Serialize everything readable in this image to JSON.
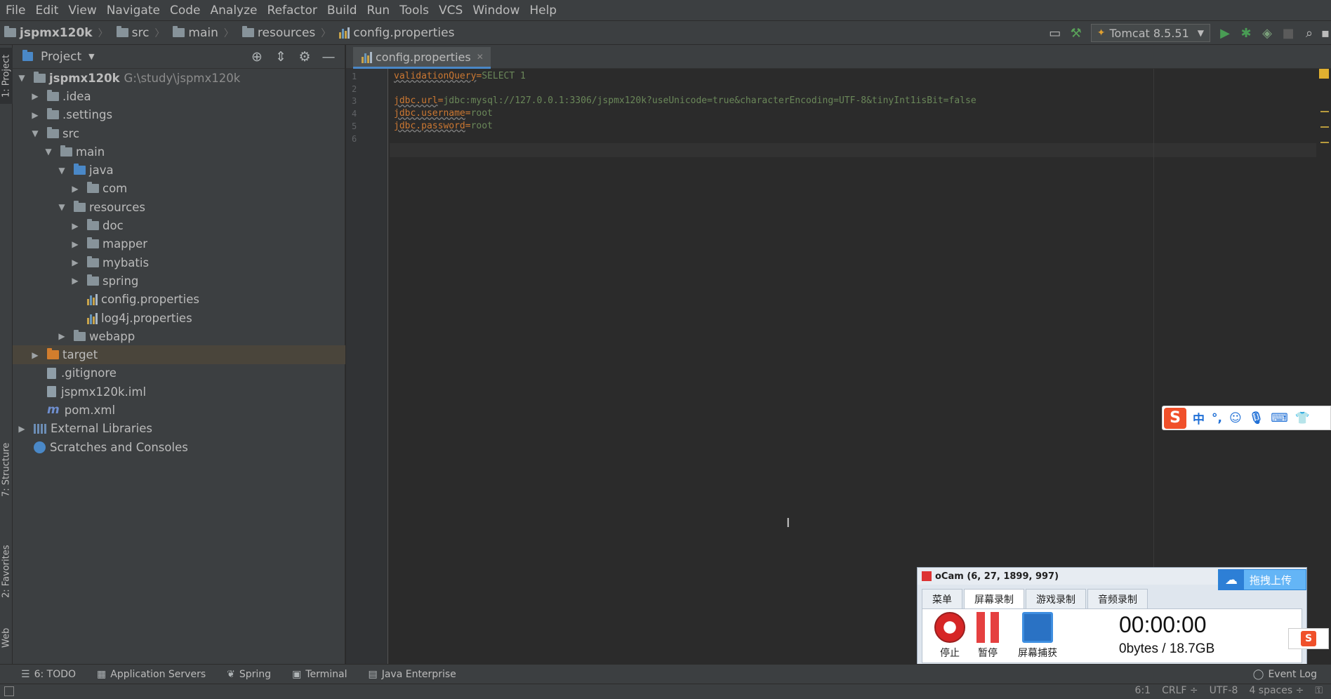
{
  "menu": [
    "File",
    "Edit",
    "View",
    "Navigate",
    "Code",
    "Analyze",
    "Refactor",
    "Build",
    "Run",
    "Tools",
    "VCS",
    "Window",
    "Help"
  ],
  "breadcrumb": [
    "jspmx120k",
    "src",
    "main",
    "resources",
    "config.properties"
  ],
  "run_config": "Tomcat 8.5.51",
  "left_tabs": {
    "project": "1: Project",
    "structure": "7: Structure",
    "favorites": "2: Favorites",
    "web": "Web"
  },
  "project_panel": {
    "title": "Project",
    "tree": [
      {
        "label": "jspmx120k",
        "sub": "G:\\study\\jspmx120k",
        "depth": 0,
        "arrow": "down",
        "icon": "module-folder-icon",
        "bold": true
      },
      {
        "label": ".idea",
        "depth": 1,
        "arrow": "right",
        "icon": "folder-icon"
      },
      {
        "label": ".settings",
        "depth": 1,
        "arrow": "right",
        "icon": "folder-icon"
      },
      {
        "label": "src",
        "depth": 1,
        "arrow": "down",
        "icon": "folder-icon"
      },
      {
        "label": "main",
        "depth": 2,
        "arrow": "down",
        "icon": "folder-icon"
      },
      {
        "label": "java",
        "depth": 3,
        "arrow": "down",
        "icon": "source-folder-icon"
      },
      {
        "label": "com",
        "depth": 4,
        "arrow": "right",
        "icon": "package-icon"
      },
      {
        "label": "resources",
        "depth": 3,
        "arrow": "down",
        "icon": "resources-folder-icon"
      },
      {
        "label": "doc",
        "depth": 4,
        "arrow": "right",
        "icon": "package-icon"
      },
      {
        "label": "mapper",
        "depth": 4,
        "arrow": "right",
        "icon": "package-icon"
      },
      {
        "label": "mybatis",
        "depth": 4,
        "arrow": "right",
        "icon": "package-icon"
      },
      {
        "label": "spring",
        "depth": 4,
        "arrow": "right",
        "icon": "package-icon"
      },
      {
        "label": "config.properties",
        "depth": 4,
        "arrow": "none",
        "icon": "properties-file-icon"
      },
      {
        "label": "log4j.properties",
        "depth": 4,
        "arrow": "none",
        "icon": "properties-file-icon"
      },
      {
        "label": "webapp",
        "depth": 3,
        "arrow": "right",
        "icon": "web-folder-icon"
      },
      {
        "label": "target",
        "depth": 1,
        "arrow": "right",
        "icon": "excluded-folder-icon",
        "selected": true
      },
      {
        "label": ".gitignore",
        "depth": 1,
        "arrow": "none",
        "icon": "text-file-icon"
      },
      {
        "label": "jspmx120k.iml",
        "depth": 1,
        "arrow": "none",
        "icon": "iml-file-icon"
      },
      {
        "label": "pom.xml",
        "depth": 1,
        "arrow": "none",
        "icon": "maven-file-icon"
      },
      {
        "label": "External Libraries",
        "depth": 0,
        "arrow": "right",
        "icon": "library-icon"
      },
      {
        "label": "Scratches and Consoles",
        "depth": 0,
        "arrow": "none",
        "icon": "scratches-icon"
      }
    ]
  },
  "editor": {
    "tab": "config.properties",
    "lines": [
      {
        "n": "1",
        "key": "validationQuery",
        "value": "SELECT 1"
      },
      {
        "n": "2",
        "key": "",
        "value": ""
      },
      {
        "n": "3",
        "key": "jdbc.url",
        "value": "jdbc:mysql://127.0.0.1:3306/jspmx120k?useUnicode=true&characterEncoding=UTF-8&tinyInt1isBit=false"
      },
      {
        "n": "4",
        "key": "jdbc.username",
        "value": "root"
      },
      {
        "n": "5",
        "key": "jdbc.password",
        "value": "root"
      },
      {
        "n": "6",
        "key": "",
        "value": ""
      }
    ]
  },
  "bottom_tabs": [
    "6: TODO",
    "Application Servers",
    "Spring",
    "Terminal",
    "Java Enterprise"
  ],
  "event_log": "Event Log",
  "status": {
    "position": "6:1",
    "line_sep": "CRLF ÷",
    "encoding": "UTF-8",
    "indent": "4 spaces ÷"
  },
  "ime": {
    "items": [
      "中",
      "°,",
      "☺",
      "🎙",
      "⌨",
      "👕"
    ]
  },
  "ocam": {
    "title": "oCam (6, 27, 1899, 997)",
    "upload": "拖拽上传",
    "tabs": [
      "菜单",
      "屏幕录制",
      "游戏录制",
      "音频录制"
    ],
    "stop": "停止",
    "pause": "暂停",
    "capture": "屏幕捕获",
    "time": "00:00:00",
    "size": "0bytes / 18.7GB"
  }
}
